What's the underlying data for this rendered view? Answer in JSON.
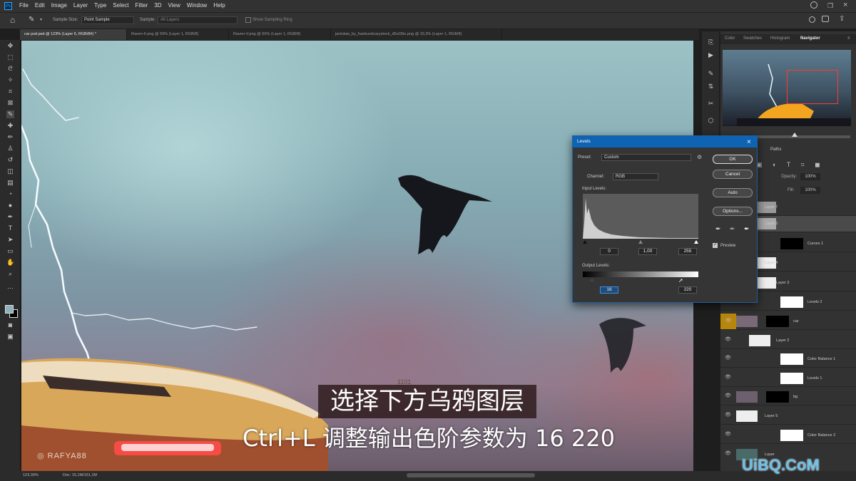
{
  "app": {
    "menu": [
      "File",
      "Edit",
      "Image",
      "Layer",
      "Type",
      "Select",
      "Filter",
      "3D",
      "View",
      "Window",
      "Help"
    ]
  },
  "options_bar": {
    "sample_size_label": "Sample Size:",
    "sample_size_value": "Point Sample",
    "sample_label": "Sample:",
    "sample_value": "All Layers",
    "show_ring_label": "Show Sampling Ring"
  },
  "tabs": [
    {
      "label": "car psd.psd @ 123% (Layer 6, RGB/8#) *"
    },
    {
      "label": "Raven-II.png @ 50% (Layer 1, RGB/8)"
    },
    {
      "label": "Raven-V.png @ 50% (Layer 1, RGB/8)"
    },
    {
      "label": "jackdaw_by_frankundcarystock_d5oI39o.png @ 33,3% (Layer 1, RGB/8)"
    }
  ],
  "status": {
    "zoom": "123,39%",
    "doc": "Doc: 15,1M/151,1M"
  },
  "canvas": {
    "watermark_text": "RAFYA88",
    "plate_text": "1101"
  },
  "panel_tabs": {
    "color": "Color",
    "swatches": "Swatches",
    "histogram": "Histogram",
    "navigator": "Navigator",
    "paths": "Paths"
  },
  "layers_panel": {
    "opacity_label": "Opacity:",
    "opacity_value": "100%",
    "fill_label": "Fill:",
    "fill_value": "100%"
  },
  "layers": [
    {
      "name": "Layer 7"
    },
    {
      "name": "Layer 6"
    },
    {
      "name": "Curves 1"
    },
    {
      "name": "Layer 4"
    },
    {
      "name": "Layer 3"
    },
    {
      "name": "Levels 2"
    },
    {
      "name": "car"
    },
    {
      "name": "Layer 2"
    },
    {
      "name": "Color Balance 1"
    },
    {
      "name": "Levels 1"
    },
    {
      "name": "bg"
    },
    {
      "name": "Layer 5"
    },
    {
      "name": "Color Balance 2"
    },
    {
      "name": "Layer"
    }
  ],
  "levels_dialog": {
    "title": "Levels",
    "preset_label": "Preset:",
    "preset_value": "Custom",
    "channel_label": "Channel:",
    "channel_value": "RGB",
    "input_levels_label": "Input Levels:",
    "input_black": "0",
    "input_gamma": "1,00",
    "input_white": "255",
    "output_levels_label": "Output Levels:",
    "output_black": "16",
    "output_white": "220",
    "ok": "OK",
    "cancel": "Cancel",
    "auto": "Auto",
    "options": "Options...",
    "preview_label": "Preview",
    "preview_checked": true
  },
  "subtitles": {
    "line1": "选择下方乌鸦图层",
    "line2": "Ctrl+L 调整输出色阶参数为 16 220"
  },
  "site_watermark": "UiBQ.CoM"
}
